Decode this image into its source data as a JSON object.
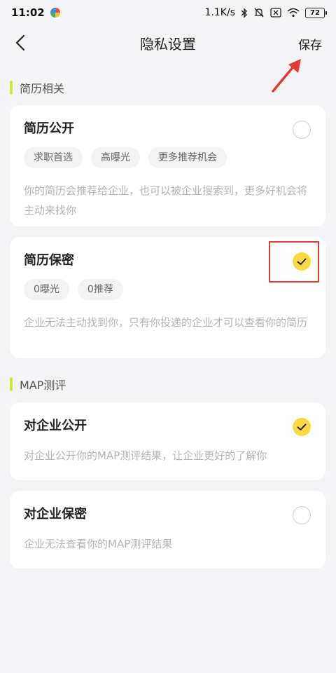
{
  "status_bar": {
    "time": "11:02",
    "net_speed": "1.1K/s",
    "battery": "72",
    "icons": [
      "app-icon",
      "bluetooth-icon",
      "mute-icon",
      "sim-icon",
      "wifi-icon",
      "battery-icon"
    ]
  },
  "nav": {
    "title": "隐私设置",
    "save_label": "保存",
    "back_icon": "chevron-left-icon"
  },
  "sections": [
    {
      "label": "简历相关",
      "cards": [
        {
          "title": "简历公开",
          "checked": false,
          "tags": [
            "求职首选",
            "高曝光",
            "更多推荐机会"
          ],
          "desc": "你的简历会推荐给企业，也可以被企业搜索到，更多好机会将主动来找你"
        },
        {
          "title": "简历保密",
          "checked": true,
          "tags": [
            "0曝光",
            "0推荐"
          ],
          "desc": "企业无法主动找到你，只有你投递的企业才可以查看你的简历"
        }
      ]
    },
    {
      "label": "MAP测评",
      "cards": [
        {
          "title": "对企业公开",
          "checked": true,
          "tags": [],
          "desc": "对企业公开你的MAP测评结果，让企业更好的了解你"
        },
        {
          "title": "对企业保密",
          "checked": false,
          "tags": [],
          "desc": "企业无法查看你的MAP测评结果"
        }
      ]
    }
  ],
  "colors": {
    "accent_yellow": "#fcd843",
    "section_bar": "#c7ec3b",
    "annotation_red": "#e53935",
    "background": "#f4f4f6"
  }
}
